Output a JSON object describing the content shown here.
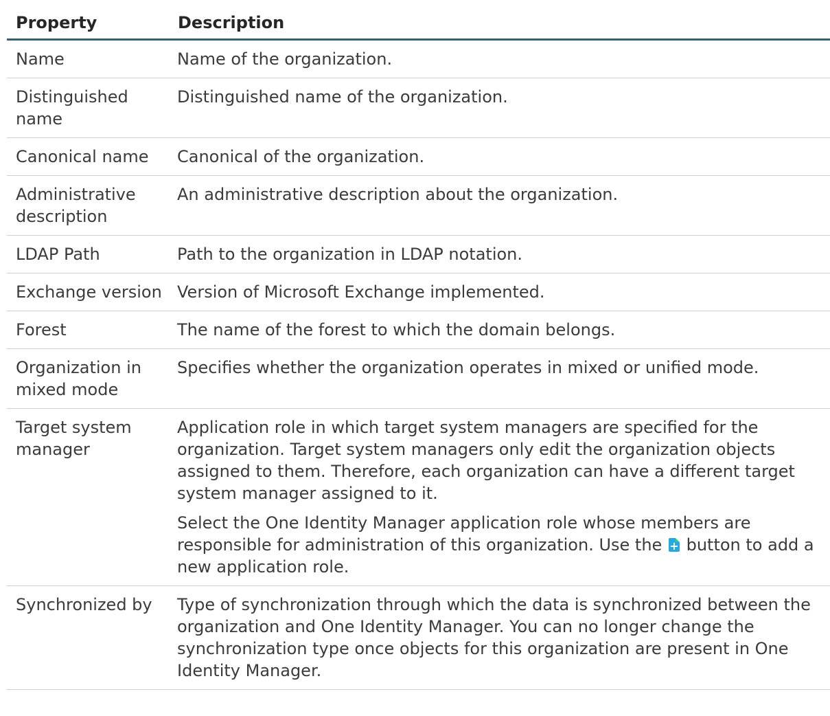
{
  "table": {
    "headers": {
      "property": "Property",
      "description": "Description"
    },
    "rows": [
      {
        "property": "Name",
        "description": "Name of the organization."
      },
      {
        "property": "Distinguished name",
        "description": "Distinguished name of the organization."
      },
      {
        "property": "Canonical name",
        "description": "Canonical of the organization."
      },
      {
        "property": "Administrative description",
        "description": "An administrative description about the organization."
      },
      {
        "property": "LDAP Path",
        "description": "Path to the organization in LDAP notation."
      },
      {
        "property": "Exchange version",
        "description": "Version of Microsoft Exchange implemented."
      },
      {
        "property": "Forest",
        "description": "The name of the forest to which the domain belongs."
      },
      {
        "property": "Organization in mixed mode",
        "description": "Specifies whether the organization operates in mixed or unified mode."
      },
      {
        "property": "Target system manager",
        "description": "Application role in which target system managers are specified for the organization. Target system managers only edit the organization objects assigned to them. Therefore, each organization can have a different target system manager assigned to it.",
        "description2_before": "Select the One Identity Manager application role whose members are responsible for administration of this organization. Use the",
        "description2_after": "button to add a new application role.",
        "icon": "add-new-icon"
      },
      {
        "property": "Synchronized by",
        "description": "Type of synchronization through which the data is synchronized between the organization and One Identity Manager. You can no longer change the synchronization type once objects for this organization are present in One Identity Manager."
      }
    ]
  },
  "colors": {
    "header_rule": "#32606f",
    "row_rule": "#cfcfcf",
    "icon_blue": "#24a9e0",
    "icon_green": "#2bd17e"
  }
}
